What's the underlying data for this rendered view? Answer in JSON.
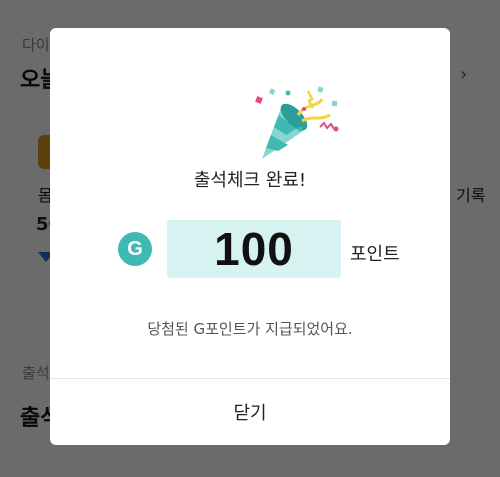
{
  "background": {
    "section1_label": "다이",
    "section1_title": "오늘",
    "side_text_1": "몸",
    "side_text_2": "5C",
    "right_text": "기록",
    "section2_label": "출석",
    "section2_title": "출석"
  },
  "dialog": {
    "title": "출석체크 완료!",
    "badge_letter": "G",
    "points_value": "100",
    "points_unit": "포인트",
    "message": "당첨된 G포인트가 지급되었어요.",
    "close_label": "닫기"
  },
  "colors": {
    "accent": "#3fb9b2",
    "points_bg": "#d6f2f1",
    "overlay": "rgba(0,0,0,0.58)"
  },
  "icons": {
    "celebration": "party-popper-icon"
  }
}
